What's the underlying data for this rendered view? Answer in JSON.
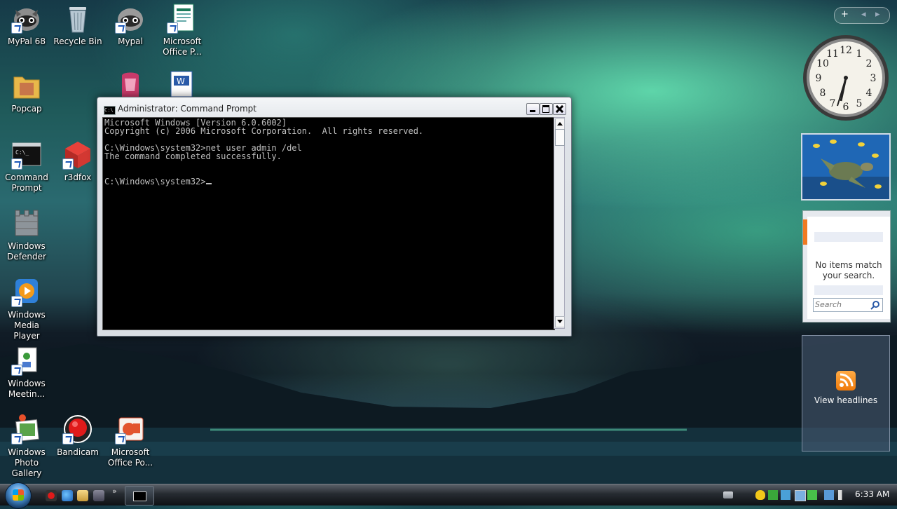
{
  "desktop": {
    "icons": [
      {
        "label": "MyPal 68"
      },
      {
        "label": "Recycle Bin"
      },
      {
        "label": "Mypal"
      },
      {
        "label": "Microsoft Office P..."
      },
      {
        "label": "Popcap"
      },
      {
        "label": "Command Prompt"
      },
      {
        "label": "r3dfox"
      },
      {
        "label": "Windows Defender"
      },
      {
        "label": "Windows Media Player"
      },
      {
        "label": "Windows Meetin..."
      },
      {
        "label": "Windows Photo Gallery"
      },
      {
        "label": "Bandicam"
      },
      {
        "label": "Microsoft Office Po..."
      }
    ]
  },
  "window": {
    "title": "Administrator: Command Prompt",
    "console": {
      "lines": [
        "Microsoft Windows [Version 6.0.6002]",
        "Copyright (c) 2006 Microsoft Corporation.  All rights reserved.",
        "",
        "C:\\Windows\\system32>net user admin /del",
        "The command completed successfully.",
        "",
        ""
      ],
      "prompt": "C:\\Windows\\system32>"
    }
  },
  "sidebar": {
    "add_glyph": "+",
    "prev_glyph": "◂",
    "next_glyph": "▸",
    "clock_numerals": [
      "12",
      "1",
      "2",
      "3",
      "4",
      "5",
      "6",
      "7",
      "8",
      "9",
      "10",
      "11"
    ],
    "feed": {
      "message": "No items match your search.",
      "search_placeholder": "Search"
    },
    "headlines": {
      "label": "View headlines"
    }
  },
  "taskbar": {
    "time": "6:33 AM"
  },
  "colors": {
    "console_bg": "#000000",
    "console_fg": "#c0c0c0",
    "rss_orange": "#f07a0a"
  }
}
